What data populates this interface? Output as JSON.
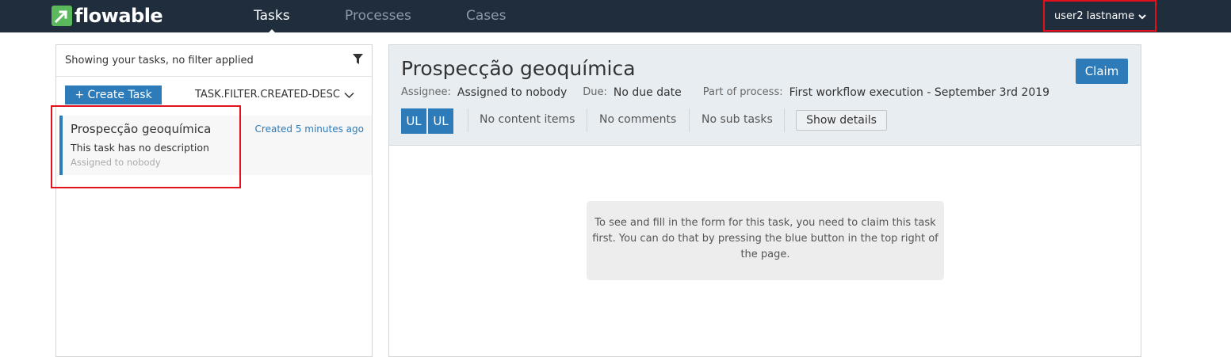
{
  "app": {
    "logo_text": "flowable",
    "nav_tabs": [
      {
        "label": "Tasks",
        "active": true
      },
      {
        "label": "Processes",
        "active": false
      },
      {
        "label": "Cases",
        "active": false
      }
    ],
    "user_menu_label": "user2 lastname"
  },
  "colors": {
    "navbar": "#1f2d3d",
    "accent": "#2d7bb8",
    "brand_green": "#5cb85c",
    "highlight": "#e2111b"
  },
  "task_list": {
    "filter_text": "Showing your tasks, no filter applied",
    "create_button_label": "+ Create Task",
    "sort_label": "TASK.FILTER.CREATED-DESC",
    "tasks": [
      {
        "title": "Prospecção geoquímica",
        "created": "Created 5 minutes ago",
        "description": "This task has no description",
        "assignee": "Assigned to nobody"
      }
    ]
  },
  "task_detail": {
    "title": "Prospecção geoquímica",
    "claim_label": "Claim",
    "meta": {
      "assignee_label": "Assignee:",
      "assignee_value": "Assigned to nobody",
      "due_label": "Due:",
      "due_value": "No due date",
      "process_label": "Part of process:",
      "process_value": "First workflow execution - September 3rd 2019"
    },
    "avatars": [
      "UL",
      "UL"
    ],
    "stats": {
      "content": "No content items",
      "comments": "No comments",
      "subtasks": "No sub tasks"
    },
    "show_details_label": "Show details",
    "claim_note": "To see and fill in the form for this task, you need to claim this task first. You can do that by pressing the blue button in the top right of the page."
  }
}
